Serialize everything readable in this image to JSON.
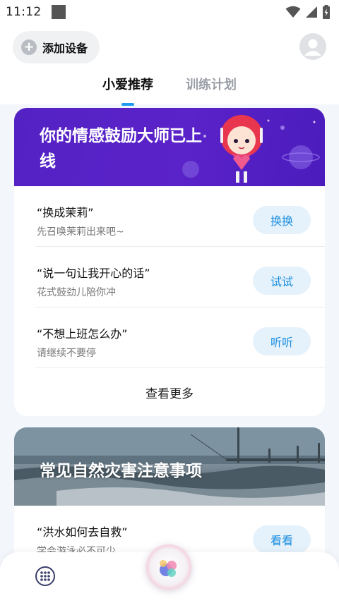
{
  "status_bar": {
    "time": "11:12"
  },
  "header": {
    "add_device_label": "添加设备",
    "tabs": [
      {
        "label": "小爱推荐",
        "active": true
      },
      {
        "label": "训练计划",
        "active": false
      }
    ]
  },
  "card1": {
    "banner_title": "你的情感鼓励大师已上线",
    "rows": [
      {
        "title": "“换成茉莉”",
        "subtitle": "先召唤茉莉出来吧~",
        "button": "换换"
      },
      {
        "title": "“说一句让我开心的话”",
        "subtitle": "花式鼓劲儿陪你冲",
        "button": "试试"
      },
      {
        "title": "“不想上班怎么办”",
        "subtitle": "请继续不要停",
        "button": "听听"
      }
    ],
    "more_label": "查看更多"
  },
  "card2": {
    "banner_title": "常见自然灾害注意事项",
    "rows": [
      {
        "title": "“洪水如何去自救”",
        "subtitle": "学会游泳必不可少",
        "button": "看看"
      }
    ]
  },
  "colors": {
    "accent": "#1e9bf0",
    "banner_purple": "#5422c4",
    "pill_bg": "#e6f2fb",
    "pill_text": "#1a8de0"
  },
  "icons": {
    "wifi": "wifi-icon",
    "signal": "signal-icon",
    "battery": "battery-icon",
    "add": "plus-icon",
    "avatar": "user-avatar-icon",
    "grid": "app-grid-icon",
    "assistant": "xiaoai-assistant-icon"
  }
}
